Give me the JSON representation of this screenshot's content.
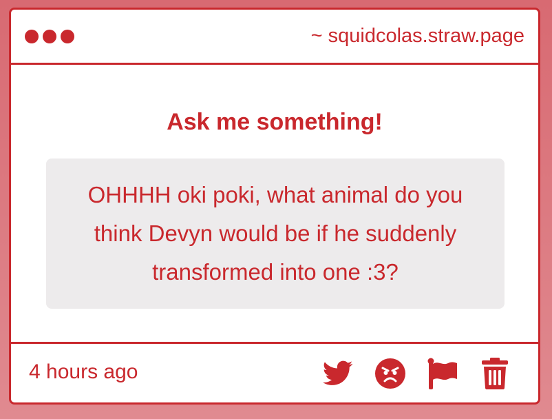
{
  "colors": {
    "accent": "#c9282d",
    "background": "#d86a72",
    "card": "#ffffff",
    "question_box": "#edebec"
  },
  "header": {
    "site": "~ squidcolas.straw.page",
    "window_dots": 3
  },
  "main": {
    "heading": "Ask me something!",
    "question": "OHHHH oki poki, what animal do you think Devyn would be if he suddenly transformed into one :3?"
  },
  "footer": {
    "timestamp": "4 hours ago",
    "actions": [
      {
        "icon": "twitter-icon"
      },
      {
        "icon": "angry-face-icon"
      },
      {
        "icon": "flag-icon"
      },
      {
        "icon": "trash-icon"
      }
    ]
  }
}
